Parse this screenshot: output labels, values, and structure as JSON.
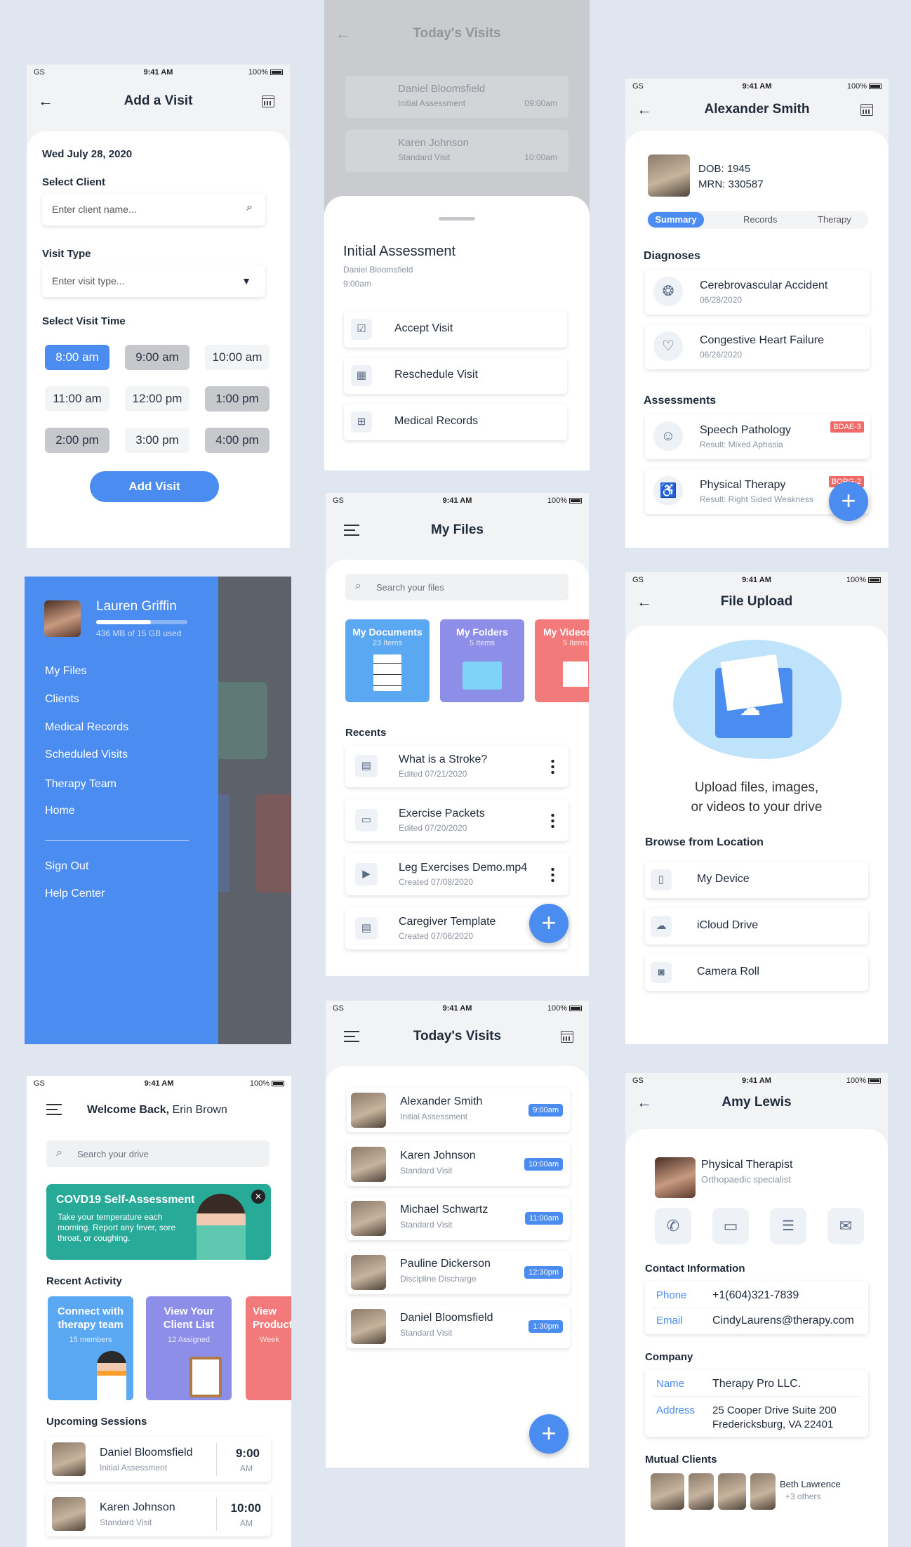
{
  "status": {
    "carrier": "GS",
    "time": "9:41 AM",
    "battery": "100%"
  },
  "add_visit": {
    "title": "Add a Visit",
    "date": "Wed July 28, 2020",
    "client_label": "Select Client",
    "client_placeholder": "Enter client name...",
    "type_label": "Visit Type",
    "type_placeholder": "Enter visit type...",
    "time_label": "Select Visit Time",
    "times": [
      "8:00 am",
      "9:00 am",
      "10:00 am",
      "11:00 am",
      "12:00 pm",
      "1:00 pm",
      "2:00 pm",
      "3:00 pm",
      "4:00 pm"
    ],
    "button": "Add Visit"
  },
  "visit_sheet": {
    "bg_title": "Today's Visits",
    "bg_rows": [
      {
        "name": "Daniel Bloomsfield",
        "sub": "Initial Assessment",
        "time": "09:00am"
      },
      {
        "name": "Karen Johnson",
        "sub": "Standard Visit",
        "time": "10:00am"
      }
    ],
    "title": "Initial Assessment",
    "client": "Daniel Bloomsfield",
    "time": "9:00am",
    "actions": [
      "Accept Visit",
      "Reschedule Visit",
      "Medical Records"
    ]
  },
  "patient": {
    "name": "Alexander Smith",
    "dob": "DOB: 1945",
    "mrn": "MRN: 330587",
    "tabs": [
      "Summary",
      "Records",
      "Therapy"
    ],
    "diagnoses_label": "Diagnoses",
    "diagnoses": [
      {
        "name": "Cerebrovascular Accident",
        "date": "06/28/2020"
      },
      {
        "name": "Congestive Heart Failure",
        "date": "06/26/2020"
      }
    ],
    "assessments_label": "Assessments",
    "assessments": [
      {
        "name": "Speech Pathology",
        "result": "Result: Mixed Aphasia",
        "tag": "BDAE-3"
      },
      {
        "name": "Physical Therapy",
        "result": "Result: Right Sided Weakness",
        "tag": "BORG-2"
      }
    ]
  },
  "menu": {
    "user": "Lauren Griffin",
    "storage": "436 MB of 15 GB used",
    "storage_pct": 0.6,
    "items": [
      "My Files",
      "Clients",
      "Medical Records",
      "Scheduled Visits",
      "Therapy Team",
      "Home"
    ],
    "bottom": [
      "Sign Out",
      "Help Center"
    ]
  },
  "files": {
    "title": "My Files",
    "search": "Search your files",
    "folders": [
      {
        "name": "My Documents",
        "count": "23 Items"
      },
      {
        "name": "My Folders",
        "count": "5 Items"
      },
      {
        "name": "My Videos",
        "count": "5 Items"
      }
    ],
    "recents_label": "Recents",
    "recents": [
      {
        "name": "What is a Stroke?",
        "date": "Edited 07/21/2020"
      },
      {
        "name": "Exercise Packets",
        "date": "Edited 07/20/2020"
      },
      {
        "name": "Leg Exercises Demo.mp4",
        "date": "Created 07/08/2020"
      },
      {
        "name": "Caregiver Template",
        "date": "Created 07/06/2020"
      }
    ]
  },
  "upload": {
    "title": "File Upload",
    "message_1": "Upload files, images,",
    "message_2": "or videos to your drive",
    "browse_label": "Browse from Location",
    "locations": [
      "My Device",
      "iCloud Drive",
      "Camera Roll"
    ]
  },
  "home": {
    "welcome": "Welcome Back,",
    "user": "Erin Brown",
    "search": "Search your drive",
    "covid_title": "COVD19 Self-Assessment",
    "covid_text": "Take your temperature each morning. Report any fever, sore throat, or coughing.",
    "recent_label": "Recent Activity",
    "recent": [
      {
        "title": "Connect with therapy team",
        "sub": "15 members"
      },
      {
        "title": "View Your Client List",
        "sub": "12 Assigned"
      },
      {
        "title": "View Products",
        "sub": "Week"
      }
    ],
    "sessions_label": "Upcoming Sessions",
    "sessions": [
      {
        "name": "Daniel Bloomsfield",
        "sub": "Initial Assessment",
        "time": "9:00",
        "ampm": "AM"
      },
      {
        "name": "Karen Johnson",
        "sub": "Standard Visit",
        "time": "10:00",
        "ampm": "AM"
      }
    ]
  },
  "today": {
    "title": "Today's Visits",
    "visits": [
      {
        "name": "Alexander Smith",
        "sub": "Initial Assessment",
        "time": "9:00am"
      },
      {
        "name": "Karen Johnson",
        "sub": "Standard Visit",
        "time": "10:00am"
      },
      {
        "name": "Michael Schwartz",
        "sub": "Standard Visit",
        "time": "11:00am"
      },
      {
        "name": "Pauline Dickerson",
        "sub": "Discipline Discharge",
        "time": "12:30pm"
      },
      {
        "name": "Daniel Bloomsfield",
        "sub": "Standard Visit",
        "time": "1:30pm"
      }
    ]
  },
  "contact": {
    "name": "Amy Lewis",
    "role": "Physical Therapist",
    "specialty": "Orthopaedic specialist",
    "info_label": "Contact Information",
    "phone_label": "Phone",
    "phone": "+1(604)321-7839",
    "email_label": "Email",
    "email": "CindyLaurens@therapy.com",
    "company_label": "Company",
    "company_name_label": "Name",
    "company_name": "Therapy Pro LLC.",
    "address_label": "Address",
    "address_1": "25 Cooper Drive Suite 200",
    "address_2": "Fredericksburg, VA 22401",
    "mutual_label": "Mutual Clients",
    "mutual_name": "Beth Lawrence",
    "mutual_more": "+3 others"
  },
  "colors": {
    "accent": "#4b8cf0",
    "teal": "#27ab98",
    "purple": "#8d8ee8",
    "coral": "#f27a7a",
    "tag": "#f06a6a"
  }
}
